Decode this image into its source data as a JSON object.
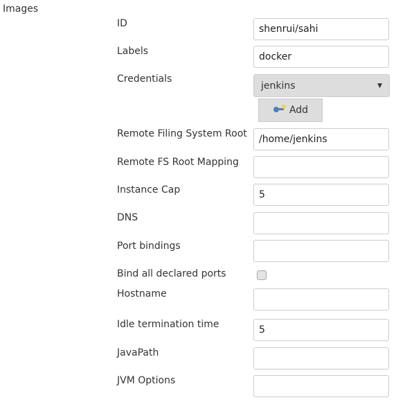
{
  "section_title": "Images",
  "fields": {
    "id": {
      "label": "ID",
      "value": "shenrui/sahi"
    },
    "labels": {
      "label": "Labels",
      "value": "docker"
    },
    "credentials": {
      "label": "Credentials",
      "value": "jenkins",
      "add_label": "Add"
    },
    "remote_fs_root": {
      "label": "Remote Filing System Root",
      "value": "/home/jenkins"
    },
    "remote_fs_mapping": {
      "label": "Remote FS Root Mapping",
      "value": ""
    },
    "instance_cap": {
      "label": "Instance Cap",
      "value": "5"
    },
    "dns": {
      "label": "DNS",
      "value": ""
    },
    "port_bindings": {
      "label": "Port bindings",
      "value": ""
    },
    "bind_all_ports": {
      "label": "Bind all declared ports",
      "checked": false
    },
    "hostname": {
      "label": "Hostname",
      "value": ""
    },
    "idle_termination": {
      "label": "Idle termination time",
      "value": "5"
    },
    "java_path": {
      "label": "JavaPath",
      "value": ""
    },
    "jvm_options": {
      "label": "JVM Options",
      "value": ""
    }
  }
}
